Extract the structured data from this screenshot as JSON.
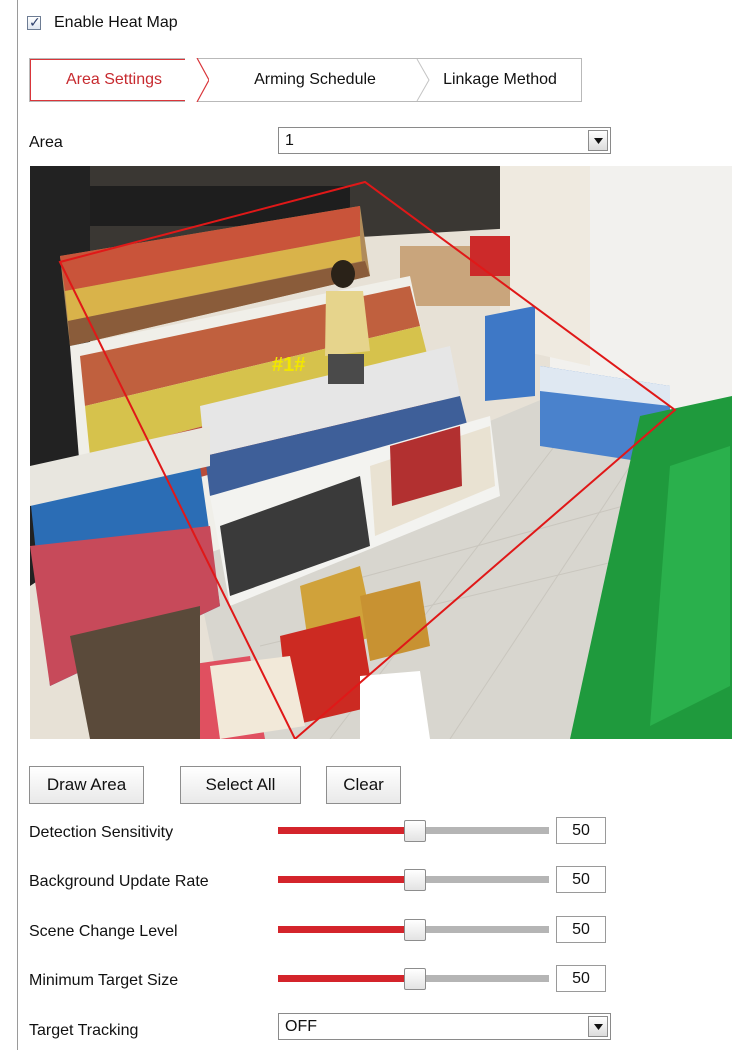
{
  "heatmap": {
    "enable_label": "Enable Heat Map",
    "enabled": true
  },
  "tabs": [
    {
      "label": "Area Settings",
      "active": true
    },
    {
      "label": "Arming Schedule",
      "active": false
    },
    {
      "label": "Linkage Method",
      "active": false
    }
  ],
  "area": {
    "label": "Area",
    "selected": "1"
  },
  "video": {
    "region_tag": "#1#"
  },
  "buttons": {
    "draw_area": "Draw Area",
    "select_all": "Select All",
    "clear": "Clear"
  },
  "params": [
    {
      "label": "Detection Sensitivity",
      "value": "50",
      "level": 0.5
    },
    {
      "label": "Background Update Rate",
      "value": "50",
      "level": 0.5
    },
    {
      "label": "Scene Change Level",
      "value": "50",
      "level": 0.5
    },
    {
      "label": "Minimum Target Size",
      "value": "50",
      "level": 0.5
    }
  ],
  "tracking": {
    "label": "Target Tracking",
    "selected": "OFF"
  },
  "colors": {
    "accent": "#d4242b",
    "active_tab": "#c72a2f",
    "region_outline": "#e01818",
    "region_tag": "#f2e600"
  },
  "icons": {
    "checkbox": "check-icon",
    "dropdown": "chevron-down-icon"
  }
}
